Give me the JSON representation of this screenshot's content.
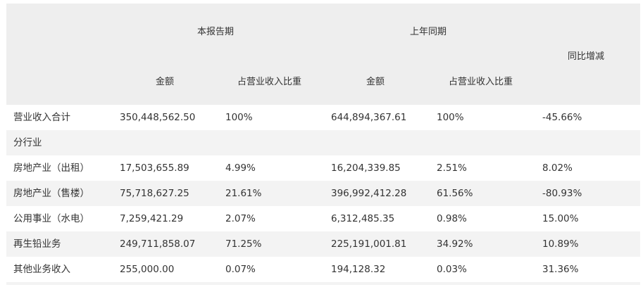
{
  "header": {
    "current_period": "本报告期",
    "prior_period": "上年同期",
    "yoy_change": "同比增减",
    "amount_current": "金额",
    "share_current": "占营业收入比重",
    "amount_prior": "金额",
    "share_prior": "占营业收入比重"
  },
  "rows": [
    {
      "label": "营业收入合计",
      "amount_current": "350,448,562.50",
      "share_current": "100%",
      "amount_prior": "644,894,367.61",
      "share_prior": "100%",
      "yoy": "-45.66%"
    },
    {
      "label": "分行业",
      "amount_current": "",
      "share_current": "",
      "amount_prior": "",
      "share_prior": "",
      "yoy": ""
    },
    {
      "label": "房地产业（出租）",
      "amount_current": "17,503,655.89",
      "share_current": "4.99%",
      "amount_prior": "16,204,339.85",
      "share_prior": "2.51%",
      "yoy": "8.02%"
    },
    {
      "label": "房地产业（售楼）",
      "amount_current": "75,718,627.25",
      "share_current": "21.61%",
      "amount_prior": "396,992,412.28",
      "share_prior": "61.56%",
      "yoy": "-80.93%"
    },
    {
      "label": "公用事业（水电）",
      "amount_current": "7,259,421.29",
      "share_current": "2.07%",
      "amount_prior": "6,312,485.35",
      "share_prior": "0.98%",
      "yoy": "15.00%"
    },
    {
      "label": "再生铅业务",
      "amount_current": "249,711,858.07",
      "share_current": "71.25%",
      "amount_prior": "225,191,001.81",
      "share_prior": "34.92%",
      "yoy": "10.89%"
    },
    {
      "label": "其他业务收入",
      "amount_current": "255,000.00",
      "share_current": "0.07%",
      "amount_prior": "194,128.32",
      "share_prior": "0.03%",
      "yoy": "31.36%"
    }
  ]
}
